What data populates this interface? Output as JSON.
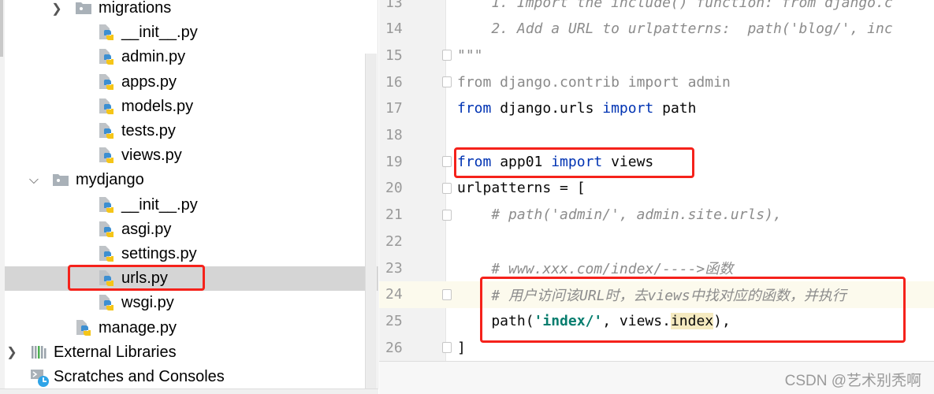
{
  "project_tree": {
    "items": [
      {
        "label": "migrations",
        "icon": "folder-icon",
        "indent": 1,
        "chevron": "right"
      },
      {
        "label": "__init__.py",
        "icon": "python-file-icon",
        "indent": 2
      },
      {
        "label": "admin.py",
        "icon": "python-file-icon",
        "indent": 2
      },
      {
        "label": "apps.py",
        "icon": "python-file-icon",
        "indent": 2
      },
      {
        "label": "models.py",
        "icon": "python-file-icon",
        "indent": 2
      },
      {
        "label": "tests.py",
        "icon": "python-file-icon",
        "indent": 2
      },
      {
        "label": "views.py",
        "icon": "python-file-icon",
        "indent": 2
      },
      {
        "label": "mydjango",
        "icon": "folder-icon",
        "indent": 0,
        "chevron": "down"
      },
      {
        "label": "__init__.py",
        "icon": "python-file-icon",
        "indent": 2
      },
      {
        "label": "asgi.py",
        "icon": "python-file-icon",
        "indent": 2
      },
      {
        "label": "settings.py",
        "icon": "python-file-icon",
        "indent": 2
      },
      {
        "label": "urls.py",
        "icon": "python-file-icon",
        "indent": 2,
        "selected": true
      },
      {
        "label": "wsgi.py",
        "icon": "python-file-icon",
        "indent": 2
      },
      {
        "label": "manage.py",
        "icon": "python-file-icon",
        "indent": 1
      },
      {
        "label": "External Libraries",
        "icon": "library-icon",
        "indent": -1,
        "chevron": "right"
      },
      {
        "label": "Scratches and Consoles",
        "icon": "scratches-icon",
        "indent": -1
      }
    ]
  },
  "editor": {
    "lines": [
      {
        "n": "13",
        "tokens": [
          {
            "t": "    1. Import the include() function: from django.c",
            "c": "cm"
          }
        ]
      },
      {
        "n": "14",
        "tokens": [
          {
            "t": "    2. Add a URL to urlpatterns:  path('blog/', inc",
            "c": "cm"
          }
        ]
      },
      {
        "n": "15",
        "fold": true,
        "tokens": [
          {
            "t": "\"\"\"",
            "c": "cm"
          }
        ]
      },
      {
        "n": "16",
        "fold": true,
        "tokens": [
          {
            "t": "from django.contrib import admin",
            "c": "dim"
          }
        ]
      },
      {
        "n": "17",
        "tokens": [
          {
            "t": "from",
            "c": "kw"
          },
          {
            "t": " django.urls ",
            "c": "pl"
          },
          {
            "t": "import",
            "c": "kw"
          },
          {
            "t": " path",
            "c": "pl"
          }
        ]
      },
      {
        "n": "18",
        "tokens": []
      },
      {
        "n": "19",
        "fold": true,
        "tokens": [
          {
            "t": "from",
            "c": "kw"
          },
          {
            "t": " app01 ",
            "c": "pl"
          },
          {
            "t": "import",
            "c": "kw"
          },
          {
            "t": " views",
            "c": "pl"
          }
        ]
      },
      {
        "n": "20",
        "fold": true,
        "tokens": [
          {
            "t": "urlpatterns = [",
            "c": "pl"
          }
        ]
      },
      {
        "n": "21",
        "fold": true,
        "tokens": [
          {
            "t": "    # path('admin/', admin.site.urls),",
            "c": "cm"
          }
        ]
      },
      {
        "n": "22",
        "tokens": []
      },
      {
        "n": "23",
        "tokens": [
          {
            "t": "    # www.xxx.com/index/---->函数",
            "c": "cm"
          }
        ]
      },
      {
        "n": "24",
        "fold": true,
        "current": true,
        "tokens": [
          {
            "t": "    # 用户访问该URL时，去views中找对应的函数，并执行",
            "c": "cm"
          }
        ]
      },
      {
        "n": "25",
        "tokens": [
          {
            "t": "    path(",
            "c": "pl"
          },
          {
            "t": "'index/'",
            "c": "st"
          },
          {
            "t": ", views.",
            "c": "pl"
          },
          {
            "t": "index",
            "c": "pl hl"
          },
          {
            "t": "),",
            "c": "pl"
          }
        ]
      },
      {
        "n": "26",
        "fold": true,
        "tokens": [
          {
            "t": "]",
            "c": "pl"
          }
        ]
      }
    ]
  },
  "watermark": "CSDN @艺术别秃啊",
  "colors": {
    "annotation_box": "#f5221b",
    "keyword": "#0033b3",
    "string": "#067d6e",
    "comment": "#8c8c8c"
  }
}
